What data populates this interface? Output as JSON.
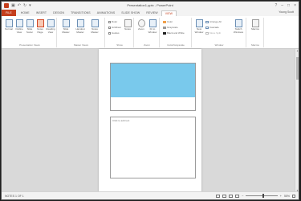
{
  "window": {
    "title": "Presentation1.pptx - PowerPoint",
    "user": "Young Scott",
    "quick_access": [
      "Save",
      "Undo",
      "Redo",
      "Customize"
    ],
    "window_controls": [
      "?",
      "–",
      "□",
      "×"
    ]
  },
  "tabs": [
    {
      "label": "FILE"
    },
    {
      "label": "HOME"
    },
    {
      "label": "INSERT"
    },
    {
      "label": "DESIGN"
    },
    {
      "label": "TRANSITIONS"
    },
    {
      "label": "ANIMATIONS"
    },
    {
      "label": "SLIDE SHOW"
    },
    {
      "label": "REVIEW"
    },
    {
      "label": "VIEW"
    }
  ],
  "active_tab": "VIEW",
  "ribbon": {
    "presentation_views": {
      "label": "Presentation Views",
      "buttons": [
        "Normal",
        "Outline View",
        "Slide Sorter",
        "Notes Page",
        "Reading View"
      ]
    },
    "master_views": {
      "label": "Master Views",
      "buttons": [
        "Slide Master",
        "Handout Master",
        "Notes Master"
      ]
    },
    "show": {
      "label": "Show",
      "items": [
        "Ruler",
        "Gridlines",
        "Guides"
      ],
      "notes_button": "Notes"
    },
    "zoom": {
      "label": "Zoom",
      "buttons": [
        "Zoom",
        "Fit to Window"
      ]
    },
    "color_grayscale": {
      "label": "Color/Grayscale",
      "items": [
        "Color",
        "Grayscale",
        "Black and White"
      ]
    },
    "window": {
      "label": "Window",
      "new_window": "New Window",
      "items": [
        "Arrange All",
        "Cascade",
        "Move Split"
      ],
      "switch_windows": "Switch Windows"
    },
    "macros": {
      "label": "Macros",
      "button": "Macros"
    }
  },
  "notes_page": {
    "notes_placeholder": "Click to add text"
  },
  "statusbar": {
    "left": "NOTES 1 OF 1",
    "zoom_percent": "55%",
    "zoom_fraction": 0.55
  }
}
